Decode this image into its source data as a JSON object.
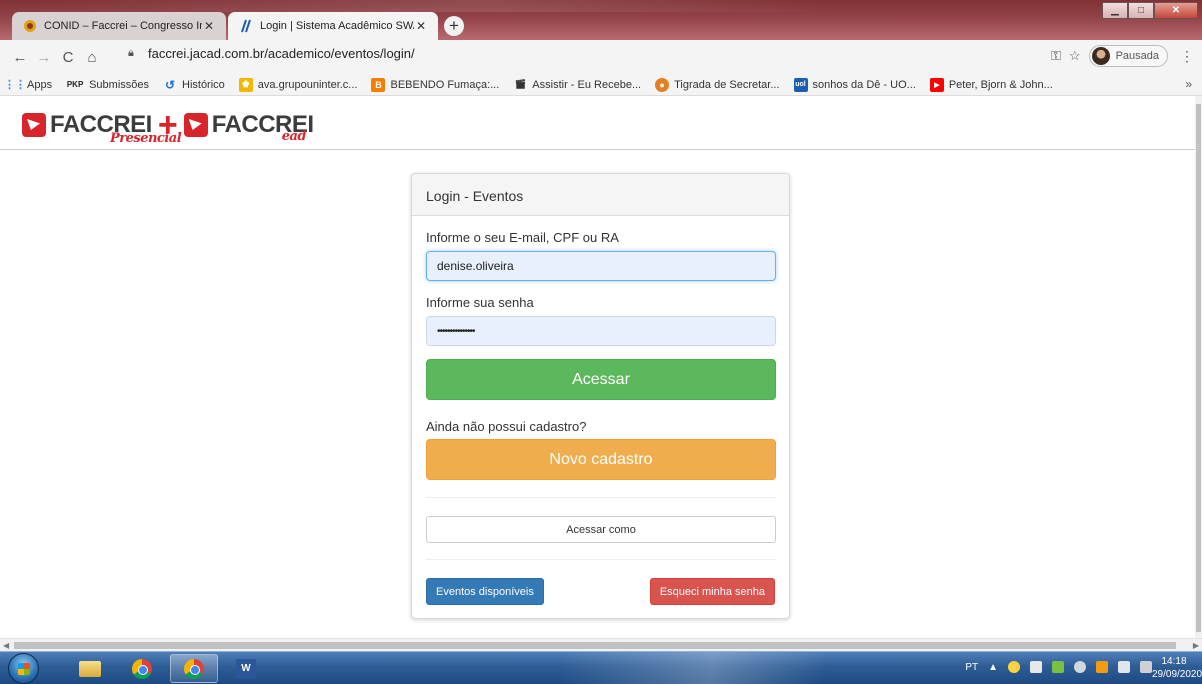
{
  "browser": {
    "tabs": [
      {
        "title": "CONID – Faccrei – Congresso Int",
        "active": false
      },
      {
        "title": "Login | Sistema Acadêmico SWA",
        "active": true
      }
    ],
    "new_tab_label": "+",
    "url": "faccrei.jacad.com.br/academico/eventos/login/",
    "profile_label": "Pausada",
    "bookmarks": [
      {
        "label": "Apps",
        "icon": "apps-grid-icon"
      },
      {
        "label": "Submissões",
        "icon": "pkp-icon",
        "badge": "PKP"
      },
      {
        "label": "Histórico",
        "icon": "history-icon"
      },
      {
        "label": "ava.grupouninter.c...",
        "icon": "uninter-icon"
      },
      {
        "label": "BEBENDO Fumaça:...",
        "icon": "blogger-icon"
      },
      {
        "label": "Assistir - Eu Recebe...",
        "icon": "clapper-icon"
      },
      {
        "label": "Tigrada de Secretar...",
        "icon": "tiger-icon"
      },
      {
        "label": "sonhos da Dê - UO...",
        "icon": "uol-icon"
      },
      {
        "label": "Peter, Bjorn & John...",
        "icon": "youtube-icon"
      }
    ],
    "bookmarks_more": "»"
  },
  "brand": {
    "left_word": "FACCREI",
    "left_script": "Presencial",
    "right_word": "FACCREI",
    "right_script": "ead",
    "colors": {
      "red": "#d8242b",
      "grey": "#3c3c3c"
    }
  },
  "login": {
    "heading": "Login - Eventos",
    "user_label": "Informe o seu E-mail, CPF ou RA",
    "user_value": "denise.oliveira",
    "password_label": "Informe sua senha",
    "password_value": "•••••••••••••••",
    "submit_label": "Acessar",
    "signup_prompt": "Ainda não possui cadastro?",
    "signup_label": "Novo cadastro",
    "access_as_label": "Acessar como",
    "events_label": "Eventos disponíveis",
    "forgot_label": "Esqueci minha senha",
    "colors": {
      "green": "#5cb85c",
      "orange": "#f0ad4e",
      "blue": "#337ab7",
      "red": "#d9534f"
    }
  },
  "taskbar": {
    "apps": [
      "start-orb",
      "windows-explorer",
      "chrome",
      "chrome-profile",
      "word"
    ],
    "word_letter": "W",
    "language": "PT",
    "time": "14:18",
    "date": "29/09/2020"
  }
}
